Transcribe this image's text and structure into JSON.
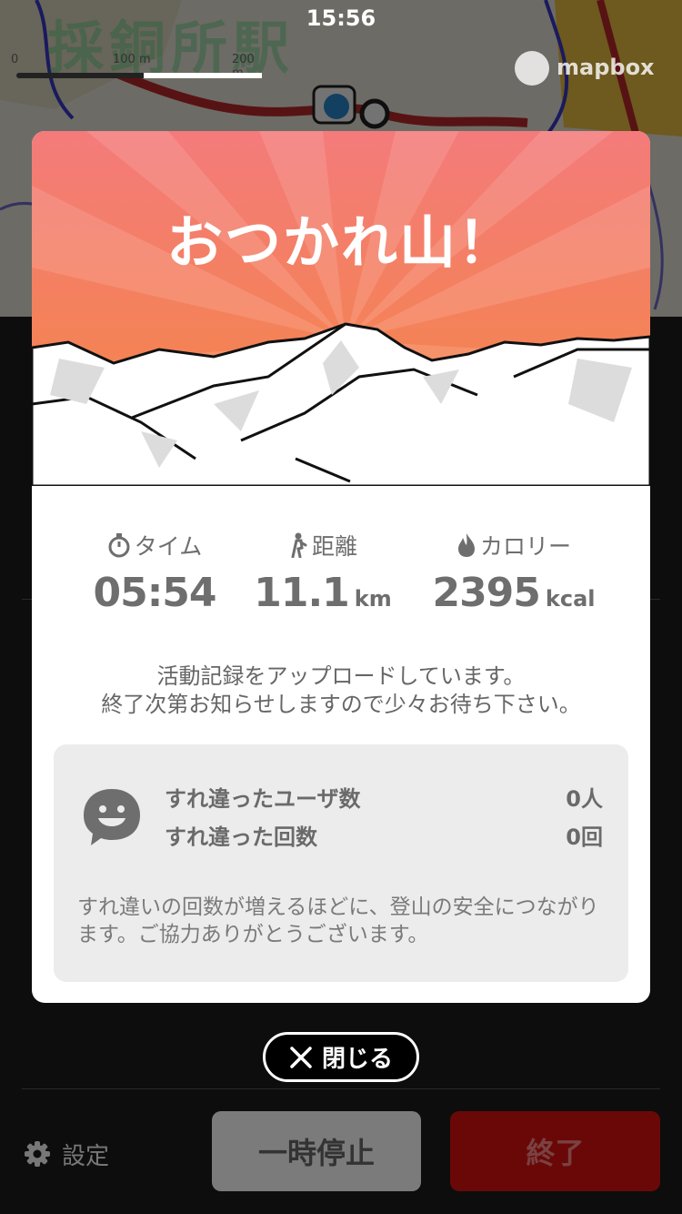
{
  "status_bar": {
    "time": "15:56"
  },
  "map": {
    "station_label": "採銅所駅",
    "scale_labels": [
      "0",
      "100 m",
      "200 m"
    ],
    "attribution": "mapbox"
  },
  "modal": {
    "title": "おつかれ山！",
    "stats": [
      {
        "icon": "stopwatch-icon",
        "label": "タイム",
        "value": "05:54",
        "unit": ""
      },
      {
        "icon": "hiker-icon",
        "label": "距離",
        "value": "11.1",
        "unit": "km"
      },
      {
        "icon": "flame-icon",
        "label": "カロリー",
        "value": "2395",
        "unit": "kcal"
      }
    ],
    "upload_message": [
      "活動記録をアップロードしています。",
      "終了次第お知らせしますので少々お待ち下さい。"
    ],
    "encounter": {
      "icon": "smiley-speech-icon",
      "rows": [
        {
          "label": "すれ違ったユーザ数",
          "value": "0人"
        },
        {
          "label": "すれ違った回数",
          "value": "0回"
        }
      ],
      "note": "すれ違いの回数が増えるほどに、登山の安全につながります。ご協力ありがとうございます。"
    }
  },
  "close_button": {
    "label": "閉じる"
  },
  "bottom_bar": {
    "settings_label": "設定",
    "pause_label": "一時停止",
    "end_label": "終了"
  },
  "colors": {
    "hero_top": "#f47b7b",
    "hero_bottom": "#f5873f",
    "end_button": "#6a0808",
    "pause_button": "#7b7b7b",
    "card_bg": "#ececec"
  }
}
